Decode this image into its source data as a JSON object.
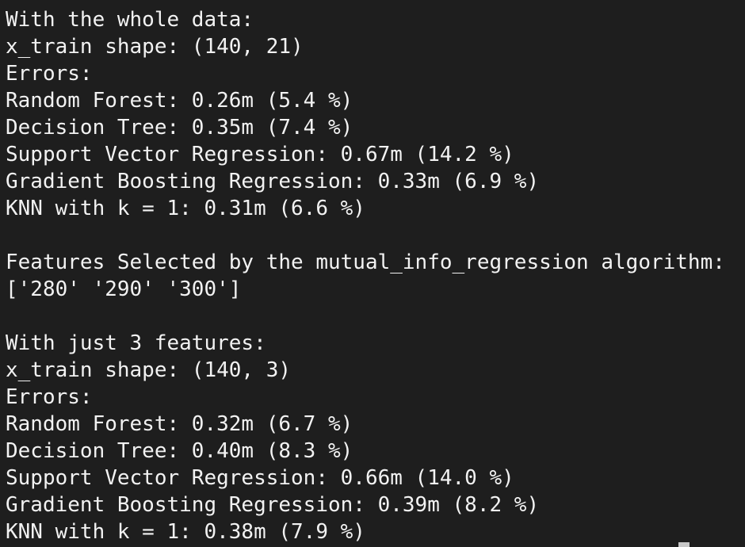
{
  "terminal": {
    "lines": [
      "With the whole data:",
      "x_train shape: (140, 21)",
      "Errors:",
      "Random Forest: 0.26m (5.4 %)",
      "Decision Tree: 0.35m (7.4 %)",
      "Support Vector Regression: 0.67m (14.2 %)",
      "Gradient Boosting Regression: 0.33m (6.9 %)",
      "KNN with k = 1: 0.31m (6.6 %)",
      "",
      "Features Selected by the mutual_info_regression algorithm:",
      "['280' '290' '300']",
      "",
      "With just 3 features:",
      "x_train shape: (140, 3)",
      "Errors:",
      "Random Forest: 0.32m (6.7 %)",
      "Decision Tree: 0.40m (8.3 %)",
      "Support Vector Regression: 0.66m (14.0 %)",
      "Gradient Boosting Regression: 0.39m (8.2 %)",
      "KNN with k = 1: 0.38m (7.9 %)"
    ]
  }
}
